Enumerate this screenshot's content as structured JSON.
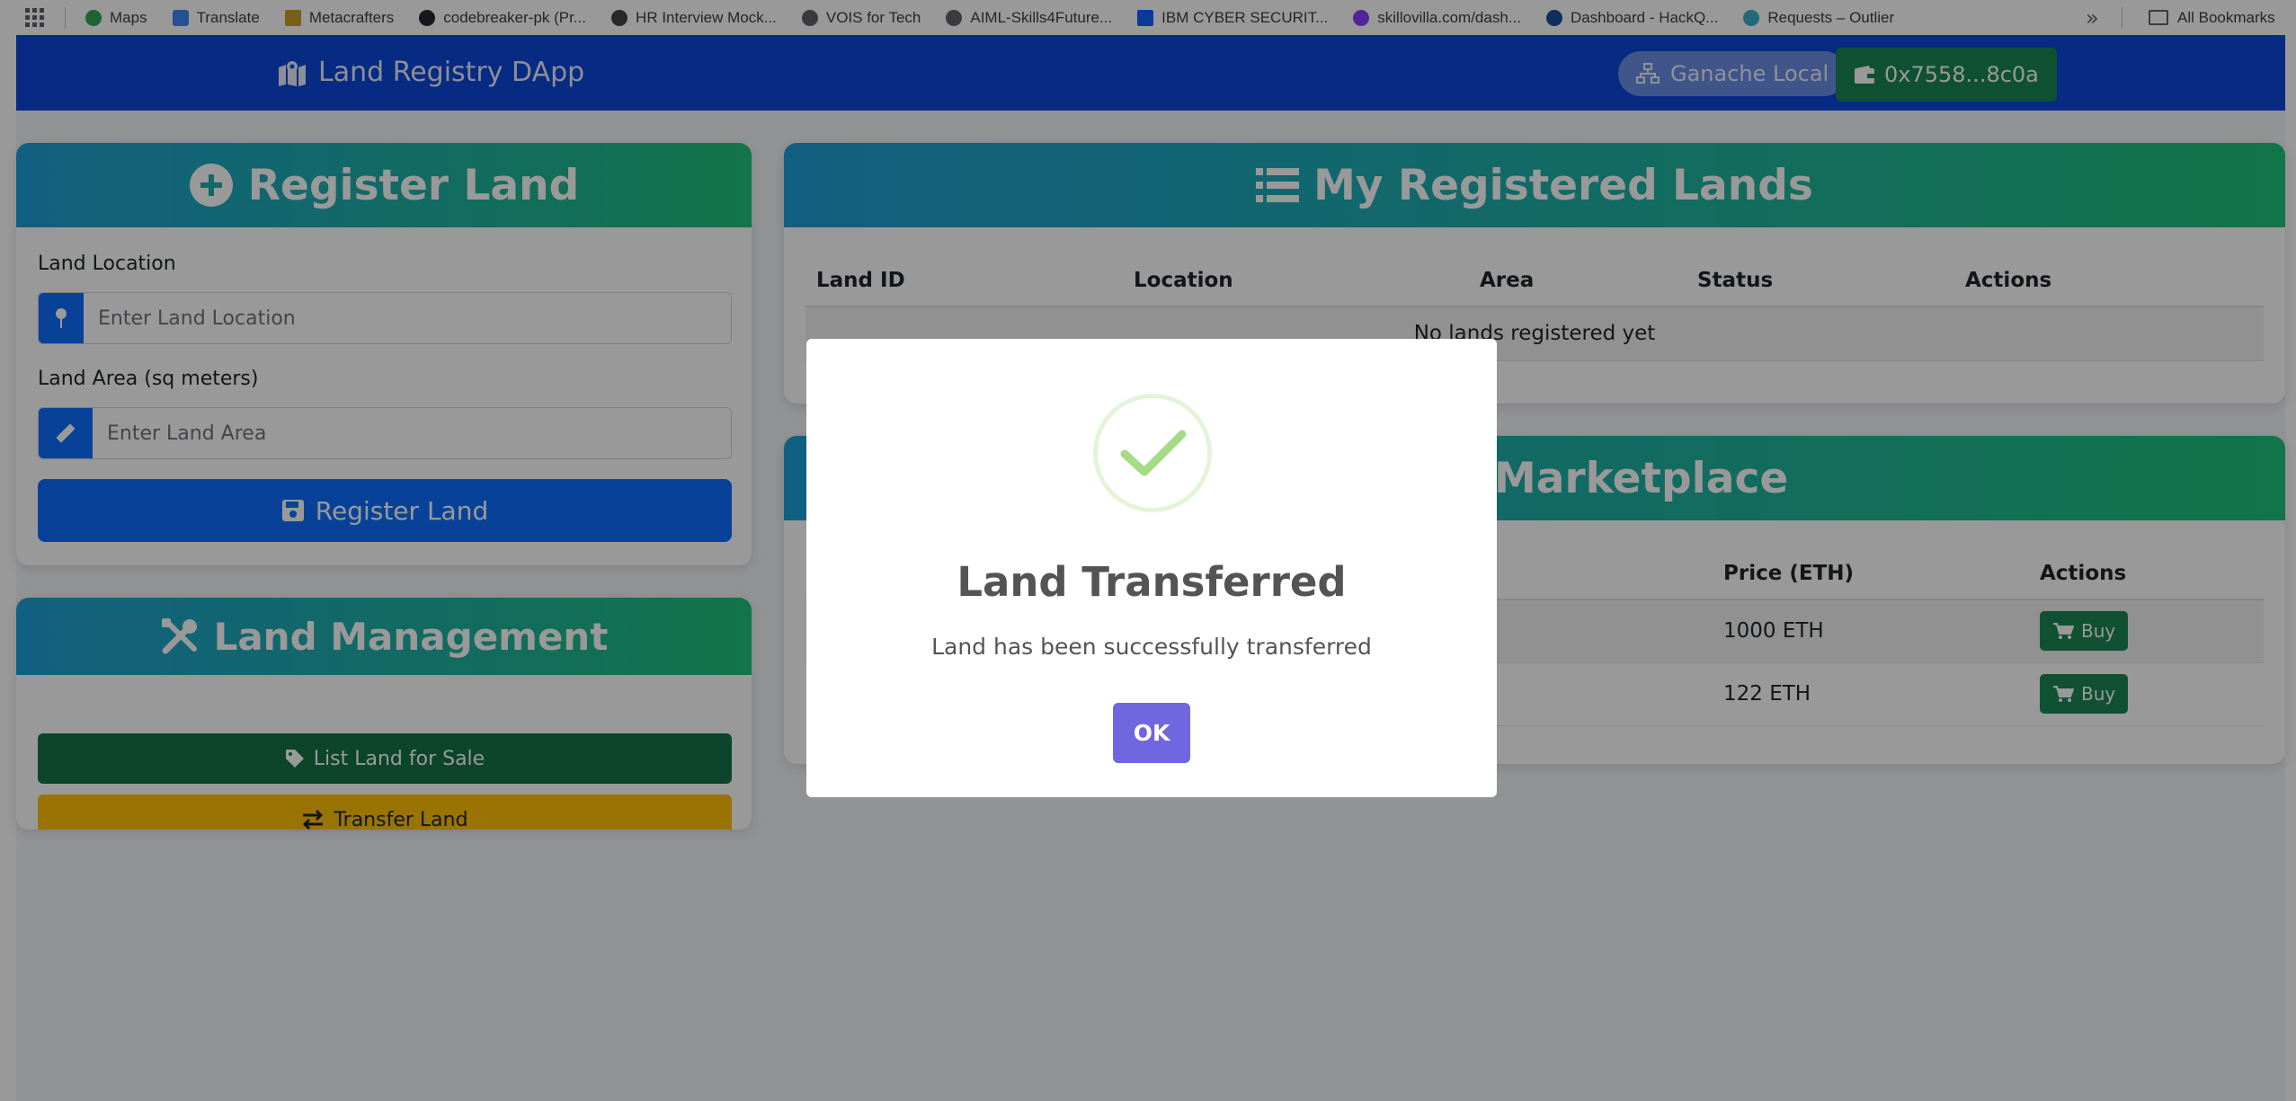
{
  "bookmarks": {
    "items": [
      {
        "label": "Maps",
        "icon": "maps-icon",
        "color": "#34a853"
      },
      {
        "label": "Translate",
        "icon": "translate-icon",
        "color": "#4285f4"
      },
      {
        "label": "Metacrafters",
        "icon": "metacrafters-icon",
        "color": "#c9a227"
      },
      {
        "label": "codebreaker-pk (Pr...",
        "icon": "github-icon",
        "color": "#24292f"
      },
      {
        "label": "HR Interview Mock...",
        "icon": "openai-icon",
        "color": "#444444"
      },
      {
        "label": "VOIS for Tech",
        "icon": "globe-icon",
        "color": "#5f6368"
      },
      {
        "label": "AIML-Skills4Future...",
        "icon": "globe-icon",
        "color": "#5f6368"
      },
      {
        "label": "IBM CYBER SECURIT...",
        "icon": "x-logo-icon",
        "color": "#0f62fe"
      },
      {
        "label": "skillovilla.com/dash...",
        "icon": "skillovilla-icon",
        "color": "#8b3dff"
      },
      {
        "label": "Dashboard - HackQ...",
        "icon": "tata-icon",
        "color": "#1b4f9c"
      },
      {
        "label": "Requests – Outlier",
        "icon": "outlier-icon",
        "color": "#3bb0c9"
      }
    ],
    "all_label": "All Bookmarks"
  },
  "navbar": {
    "brand": "Land Registry DApp",
    "network": "Ganache Local",
    "account": "0x7558...8c0a"
  },
  "register": {
    "title": "Register Land",
    "location_label": "Land Location",
    "location_placeholder": "Enter Land Location",
    "area_label": "Land Area (sq meters)",
    "area_placeholder": "Enter Land Area",
    "submit_label": "Register Land"
  },
  "management": {
    "title": "Land Management",
    "list_label": "List Land for Sale",
    "transfer_label": "Transfer Land"
  },
  "my_lands": {
    "title": "My Registered Lands",
    "columns": [
      "Land ID",
      "Location",
      "Area",
      "Status",
      "Actions"
    ],
    "empty_text": "No lands registered yet"
  },
  "marketplace": {
    "title": "Marketplace",
    "columns": [
      "Price (ETH)",
      "Actions"
    ],
    "rows": [
      {
        "price": "1000 ETH",
        "action": "Buy"
      },
      {
        "price": "122 ETH",
        "action": "Buy"
      }
    ]
  },
  "modal": {
    "title": "Land Transferred",
    "text": "Land has been successfully transferred",
    "ok_label": "OK",
    "success_color": "#a5dc86"
  }
}
